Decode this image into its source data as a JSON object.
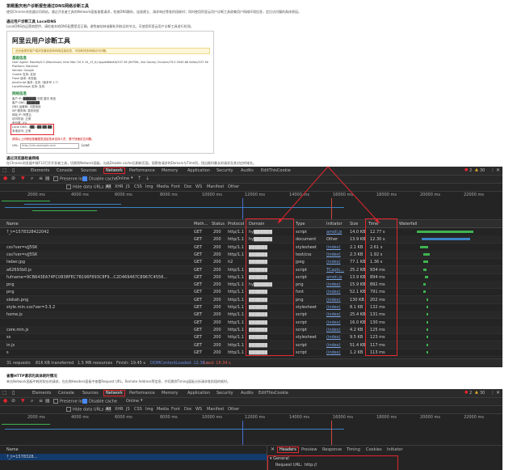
{
  "doc": {
    "heading1": "第题重庆用户诊断报告通过DNS网络诊断工具",
    "para1": "使用Chrome浏览器访问网站，通过开发者工具的Network面板查看请求，检查DNS解析、连接建立、请求响应等各阶段耗时；同时使用阿里云用户诊断工具收集用户网络环境信息，定位访问慢的具体原因。",
    "heading2": "通过用户诊断工具 LocalDNS",
    "para2": "LocalDNS由运营商提供，请检查本地DNS配置是否正确，避免被劫持或解析到较远的节点。可使用阿里云用户诊断工具进行检测。"
  },
  "diag": {
    "title": "阿里云用户诊断工具",
    "note": "此页面提供客户端浏览器信息和网络连接信息，可协助排查网络访问问题。",
    "sec_browser": "基础信息",
    "rows_browser": [
      "User Agent: Mozilla/5.0 (Macintosh; Intel Mac OS X 10_13_6) AppleWebKit/537.36 (KHTML, like Gecko) Chrome/79.0.3945.88 Safari/537.36",
      "Platform: MacIntel",
      "Vendor: Google",
      "Cookie 支持: 支持",
      "Flash 版本: 未安装",
      "JavaScript 版本: 支持（版本号 1.7）",
      "LocalStorage 支持: 支持"
    ],
    "sec_network": "网络信息",
    "rows_network": [
      "客户 IP: ██████ 中国 重庆 电信",
      "客户 DNS: ██████",
      "DNS 运营商: 中国电信",
      "ISP 服务商: 重庆电信",
      "网站 IP: 阿里云",
      "访问时延: 正常",
      "丢包率: 0%",
      "Local DNS: 1██.1██.██.██",
      "本地访问: 正常"
    ],
    "footer": "请将以上诊断信息截图发送给技术支持人员，便于快速定位问题。",
    "url_label": "URL：",
    "url_value": "http://cdn.example.com",
    "load_btn": "Load"
  },
  "mid": {
    "heading": "通过浏览器检查网络",
    "para": "在Chrome浏览器中按F12打开开发者工具，切换到Network面板，勾选Disable cache后刷新页面，观察各请求的Domain与Time列，找出耗时最长的请求及其对应的域名。"
  },
  "devtools": {
    "tabs": [
      "Elements",
      "Console",
      "Sources",
      "Network",
      "Performance",
      "Memory",
      "Application",
      "Security",
      "Audits",
      "EditThisCookie"
    ],
    "active_tab": "Network",
    "errors": "2",
    "warnings": "30",
    "toolbar": {
      "preserve_log": "Preserve log",
      "disable_cache": "Disable cache",
      "throttle": "Online"
    },
    "filters": [
      "Hide data URLs",
      "All",
      "XHR",
      "JS",
      "CSS",
      "Img",
      "Media",
      "Font",
      "Doc",
      "WS",
      "Manifest",
      "Other"
    ],
    "ticks": [
      "2000 ms",
      "4000 ms",
      "6000 ms",
      "8000 ms",
      "10000 ms",
      "12000 ms",
      "14000 ms",
      "16000 ms",
      "18000 ms",
      "20000 ms",
      "22000 ms"
    ],
    "columns": [
      "Name",
      "Meth...",
      "Status",
      "Protocol",
      "Domain",
      "Type",
      "Initiator",
      "Size",
      "Time",
      "Waterfall"
    ],
    "rows": [
      {
        "name": "?_t=1578328422042",
        "method": "GET",
        "status": "200",
        "protocol": "http/1.1",
        "domain": "hy██████",
        "type": "script",
        "initiator": "amoli.js",
        "size": "14.0 KB",
        "time": "12.77 s"
      },
      {
        "name": "",
        "method": "GET",
        "status": "200",
        "protocol": "http/1.1",
        "domain": "hy██████",
        "type": "document",
        "initiator": "Other",
        "size": "13.9 KB",
        "time": "12.30 s"
      },
      {
        "name": "css?ver=vjJ5SK",
        "method": "GET",
        "status": "200",
        "protocol": "http/1.1",
        "domain": "██████",
        "type": "stylesheet",
        "initiator": "(index)",
        "size": "2.1 KB",
        "time": "2.61 s"
      },
      {
        "name": "css?ver=vjJ5SK",
        "method": "GET",
        "status": "200",
        "protocol": "http/1.1",
        "domain": "██████",
        "type": "text/css",
        "initiator": "(index)",
        "size": "2.3 KB",
        "time": "1.92 s"
      },
      {
        "name": "lieber.jpg",
        "method": "GET",
        "status": "200",
        "protocol": "h2",
        "domain": "██████",
        "type": "jpeg",
        "initiator": "(index)",
        "size": "77.1 KB",
        "time": "1.36 s"
      },
      {
        "name": "a62693b0.js",
        "method": "GET",
        "status": "200",
        "protocol": "http/1.1",
        "domain": "██████",
        "type": "script",
        "initiator": "TCaptc...",
        "size": "25.2 KB",
        "time": "934 ms"
      },
      {
        "name": "fufname=9CB643EA74FC0838FEC7B196F893C8F9...C2D469467C8967C4556...",
        "method": "GET",
        "status": "200",
        "protocol": "http/1.1",
        "domain": "██████",
        "type": "script",
        "initiator": "amoli.js",
        "size": "13.9 KB",
        "time": "894 ms"
      },
      {
        "name": "png",
        "method": "GET",
        "status": "200",
        "protocol": "http/1.1",
        "domain": "hy██████",
        "type": "png",
        "initiator": "(index)",
        "size": "15.9 KB",
        "time": "892 ms"
      },
      {
        "name": "png",
        "method": "GET",
        "status": "200",
        "protocol": "http/1.1",
        "domain": "██████",
        "type": "font",
        "initiator": "(index)",
        "size": "52.1 KB",
        "time": "791 ms"
      },
      {
        "name": "slokah.png",
        "method": "GET",
        "status": "200",
        "protocol": "http/1.1",
        "domain": "██████",
        "type": "png",
        "initiator": "(index)",
        "size": "130 KB",
        "time": "202 ms"
      },
      {
        "name": "style.min.css?ver=3.3.2",
        "method": "GET",
        "status": "200",
        "protocol": "http/1.1",
        "domain": "██████",
        "type": "stylesheet",
        "initiator": "(index)",
        "size": "8.1 KB",
        "time": "132 ms"
      },
      {
        "name": "home.js",
        "method": "GET",
        "status": "200",
        "protocol": "http/1.1",
        "domain": "██████",
        "type": "script",
        "initiator": "(index)",
        "size": "25.4 KB",
        "time": "131 ms"
      },
      {
        "name": "",
        "method": "GET",
        "status": "200",
        "protocol": "http/1.1",
        "domain": "██████",
        "type": "script",
        "initiator": "(index)",
        "size": "16.0 KB",
        "time": "130 ms"
      },
      {
        "name": "core.min.js",
        "method": "GET",
        "status": "200",
        "protocol": "http/1.1",
        "domain": "██████",
        "type": "script",
        "initiator": "(index)",
        "size": "4.2 KB",
        "time": "125 ms"
      },
      {
        "name": "ss",
        "method": "GET",
        "status": "200",
        "protocol": "http/1.1",
        "domain": "██████",
        "type": "stylesheet",
        "initiator": "(index)",
        "size": "9.5 KB",
        "time": "123 ms"
      },
      {
        "name": "in.js",
        "method": "GET",
        "status": "200",
        "protocol": "http/1.1",
        "domain": "██████",
        "type": "script",
        "initiator": "(index)",
        "size": "51.4 KB",
        "time": "117 ms"
      },
      {
        "name": "s",
        "method": "GET",
        "status": "200",
        "protocol": "http/1.1",
        "domain": "██████",
        "type": "script",
        "initiator": "(index)",
        "size": "1.2 KB",
        "time": "113 ms"
      }
    ],
    "status": {
      "requests": "31 requests",
      "transferred": "816 KB transferred",
      "resources": "1.5 MB resources",
      "finish": "Finish: 19.45 s",
      "dcl": "DOMContentLoaded: 12.38 s",
      "load": "Load: 16.34 s"
    }
  },
  "lower": {
    "heading": "查看HTTP请求的具体耗时情况",
    "para": "单击Network面板中耗时较长的请求，在右侧Headers面板中查看Request URL、Remote Address等信息，并切换到Timing面板分析请求各阶段的耗时。",
    "name_col": "Name",
    "sel_row": "?_t=1578328...",
    "panel_tabs": [
      "Headers",
      "Preview",
      "Response",
      "Timing",
      "Cookies",
      "Initiator"
    ],
    "general": "General",
    "request_url_label": "Request URL:",
    "request_url_value": "http://"
  }
}
